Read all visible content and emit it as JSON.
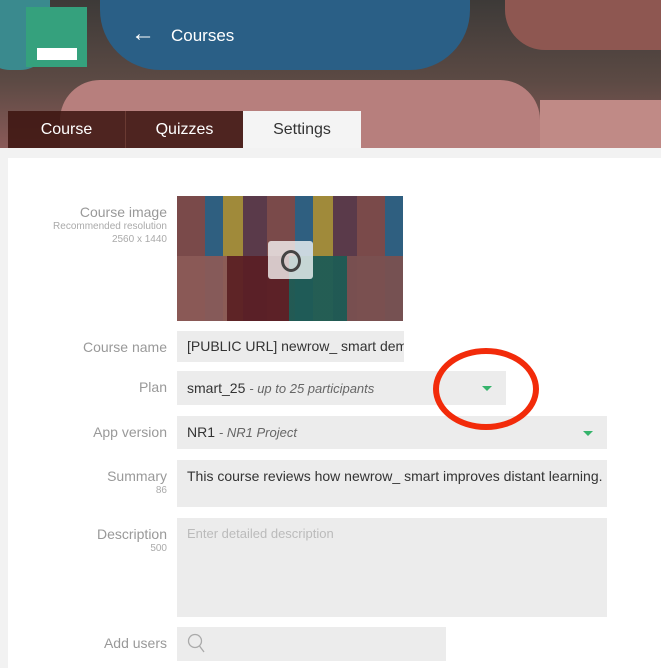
{
  "header": {
    "title": "Courses",
    "back_icon": "arrow-left-icon"
  },
  "tabs": [
    {
      "label": "Course"
    },
    {
      "label": "Quizzes"
    },
    {
      "label": "Settings",
      "active": true
    }
  ],
  "form": {
    "course_image": {
      "label": "Course image",
      "hint": "Recommended resolution",
      "resolution": "2560 x 1440",
      "icon": "camera-icon"
    },
    "course_name": {
      "label": "Course name",
      "value": "[PUBLIC URL] newrow_ smart demo"
    },
    "plan": {
      "label": "Plan",
      "value": "smart_25",
      "detail": "- up to 25 participants"
    },
    "app_version": {
      "label": "App version",
      "value": "NR1",
      "detail": "- NR1 Project"
    },
    "summary": {
      "label": "Summary",
      "count": "86",
      "value": "This course reviews how newrow_ smart improves distant learning."
    },
    "description": {
      "label": "Description",
      "count": "500",
      "placeholder": "Enter detailed description"
    },
    "add_users": {
      "label": "Add users",
      "icon": "search-icon"
    }
  },
  "colors": {
    "accent": "#35a17d",
    "caret": "#35b36b",
    "annotation": "#f22b0a"
  }
}
